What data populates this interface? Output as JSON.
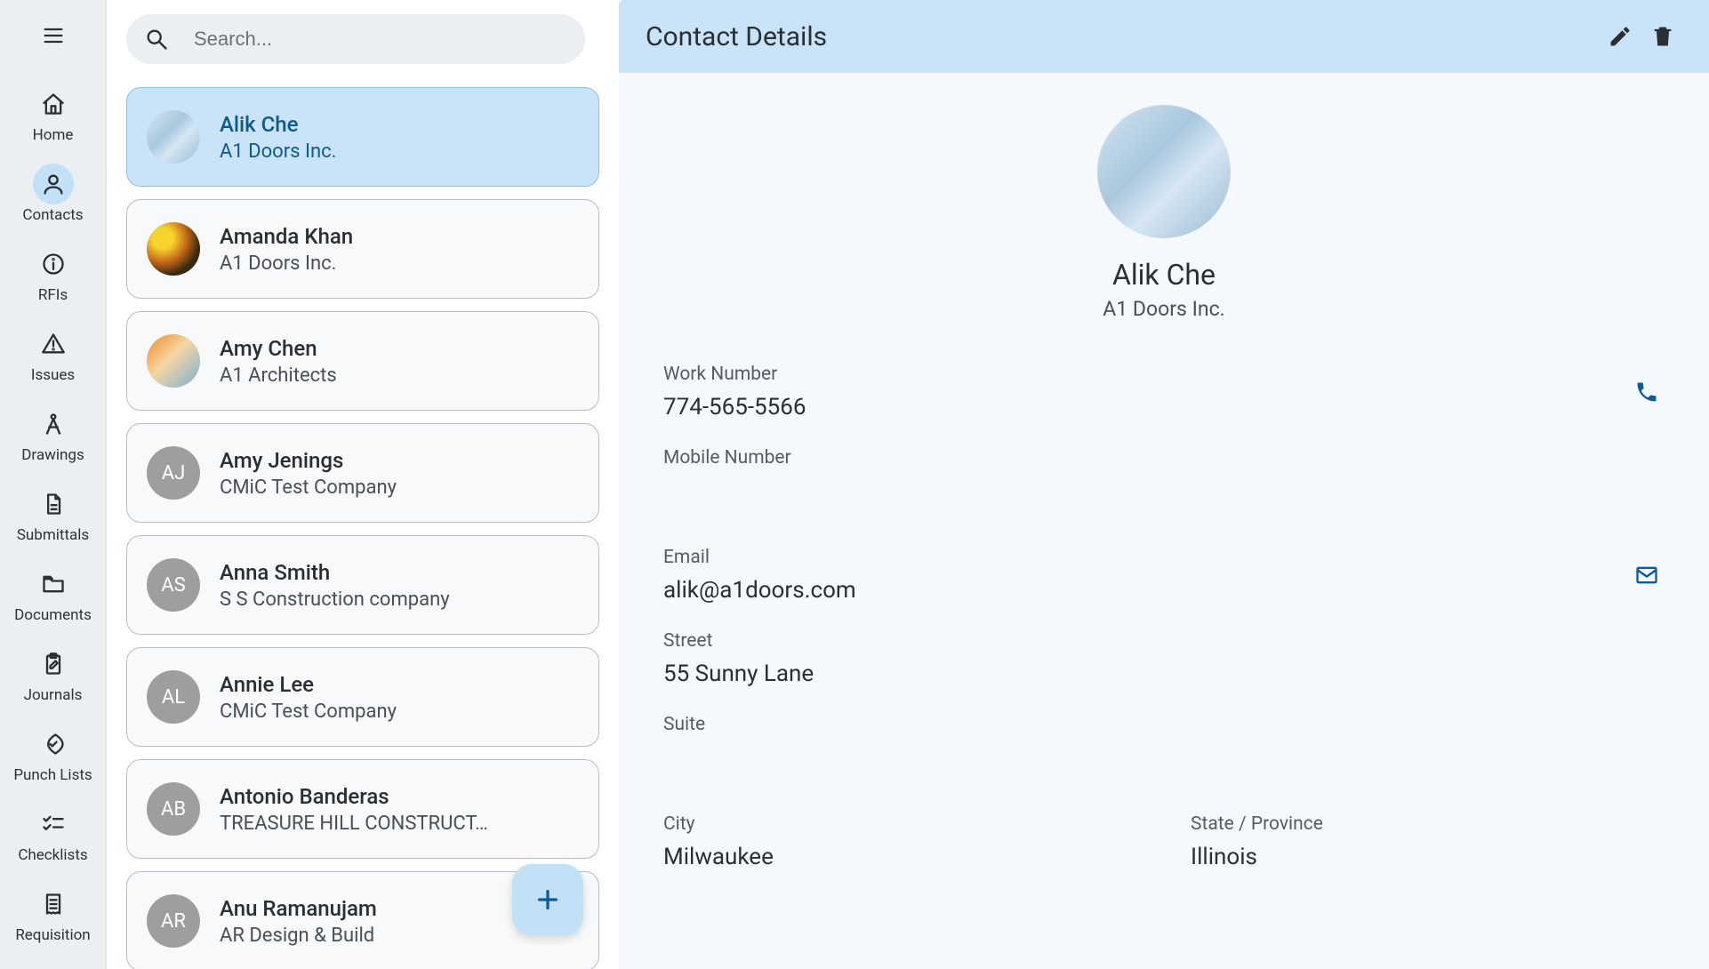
{
  "nav": {
    "items": [
      {
        "label": "Home",
        "icon": "home-icon"
      },
      {
        "label": "Contacts",
        "icon": "person-icon",
        "active": true
      },
      {
        "label": "RFIs",
        "icon": "info-icon"
      },
      {
        "label": "Issues",
        "icon": "warning-icon"
      },
      {
        "label": "Drawings",
        "icon": "compass-icon"
      },
      {
        "label": "Submittals",
        "icon": "file-icon"
      },
      {
        "label": "Documents",
        "icon": "folder-icon"
      },
      {
        "label": "Journals",
        "icon": "clipboard-icon"
      },
      {
        "label": "Punch Lists",
        "icon": "target-check-icon"
      },
      {
        "label": "Checklists",
        "icon": "checklist-icon"
      },
      {
        "label": "Requisition",
        "icon": "receipt-icon"
      }
    ]
  },
  "search": {
    "placeholder": "Search..."
  },
  "contacts": [
    {
      "name": "Alik Che",
      "company": "A1 Doors Inc.",
      "initials": "",
      "avatar_kind": "img-blueprint",
      "selected": true
    },
    {
      "name": "Amanda Khan",
      "company": "A1 Doors Inc.",
      "initials": "",
      "avatar_kind": "img-flowers"
    },
    {
      "name": "Amy Chen",
      "company": "A1 Architects",
      "initials": "",
      "avatar_kind": "img-crane"
    },
    {
      "name": "Amy Jenings",
      "company": "CMiC Test Company",
      "initials": "AJ",
      "avatar_kind": "initials"
    },
    {
      "name": "Anna Smith",
      "company": "S S Construction company",
      "initials": "AS",
      "avatar_kind": "initials"
    },
    {
      "name": "Annie Lee",
      "company": "CMiC Test Company",
      "initials": "AL",
      "avatar_kind": "initials"
    },
    {
      "name": "Antonio Banderas",
      "company": "TREASURE HILL CONSTRUCT…",
      "initials": "AB",
      "avatar_kind": "initials"
    },
    {
      "name": "Anu Ramanujam",
      "company": "AR Design & Build",
      "initials": "AR",
      "avatar_kind": "initials"
    }
  ],
  "detail": {
    "header_title": "Contact Details",
    "name": "Alik Che",
    "company": "A1 Doors Inc.",
    "fields": {
      "work_number_label": "Work Number",
      "work_number_value": "774-565-5566",
      "mobile_number_label": "Mobile Number",
      "mobile_number_value": "",
      "email_label": "Email",
      "email_value": "alik@a1doors.com",
      "street_label": "Street",
      "street_value": "55 Sunny Lane",
      "suite_label": "Suite",
      "suite_value": "",
      "city_label": "City",
      "city_value": "Milwaukee",
      "state_label": "State / Province",
      "state_value": "Illinois"
    }
  }
}
